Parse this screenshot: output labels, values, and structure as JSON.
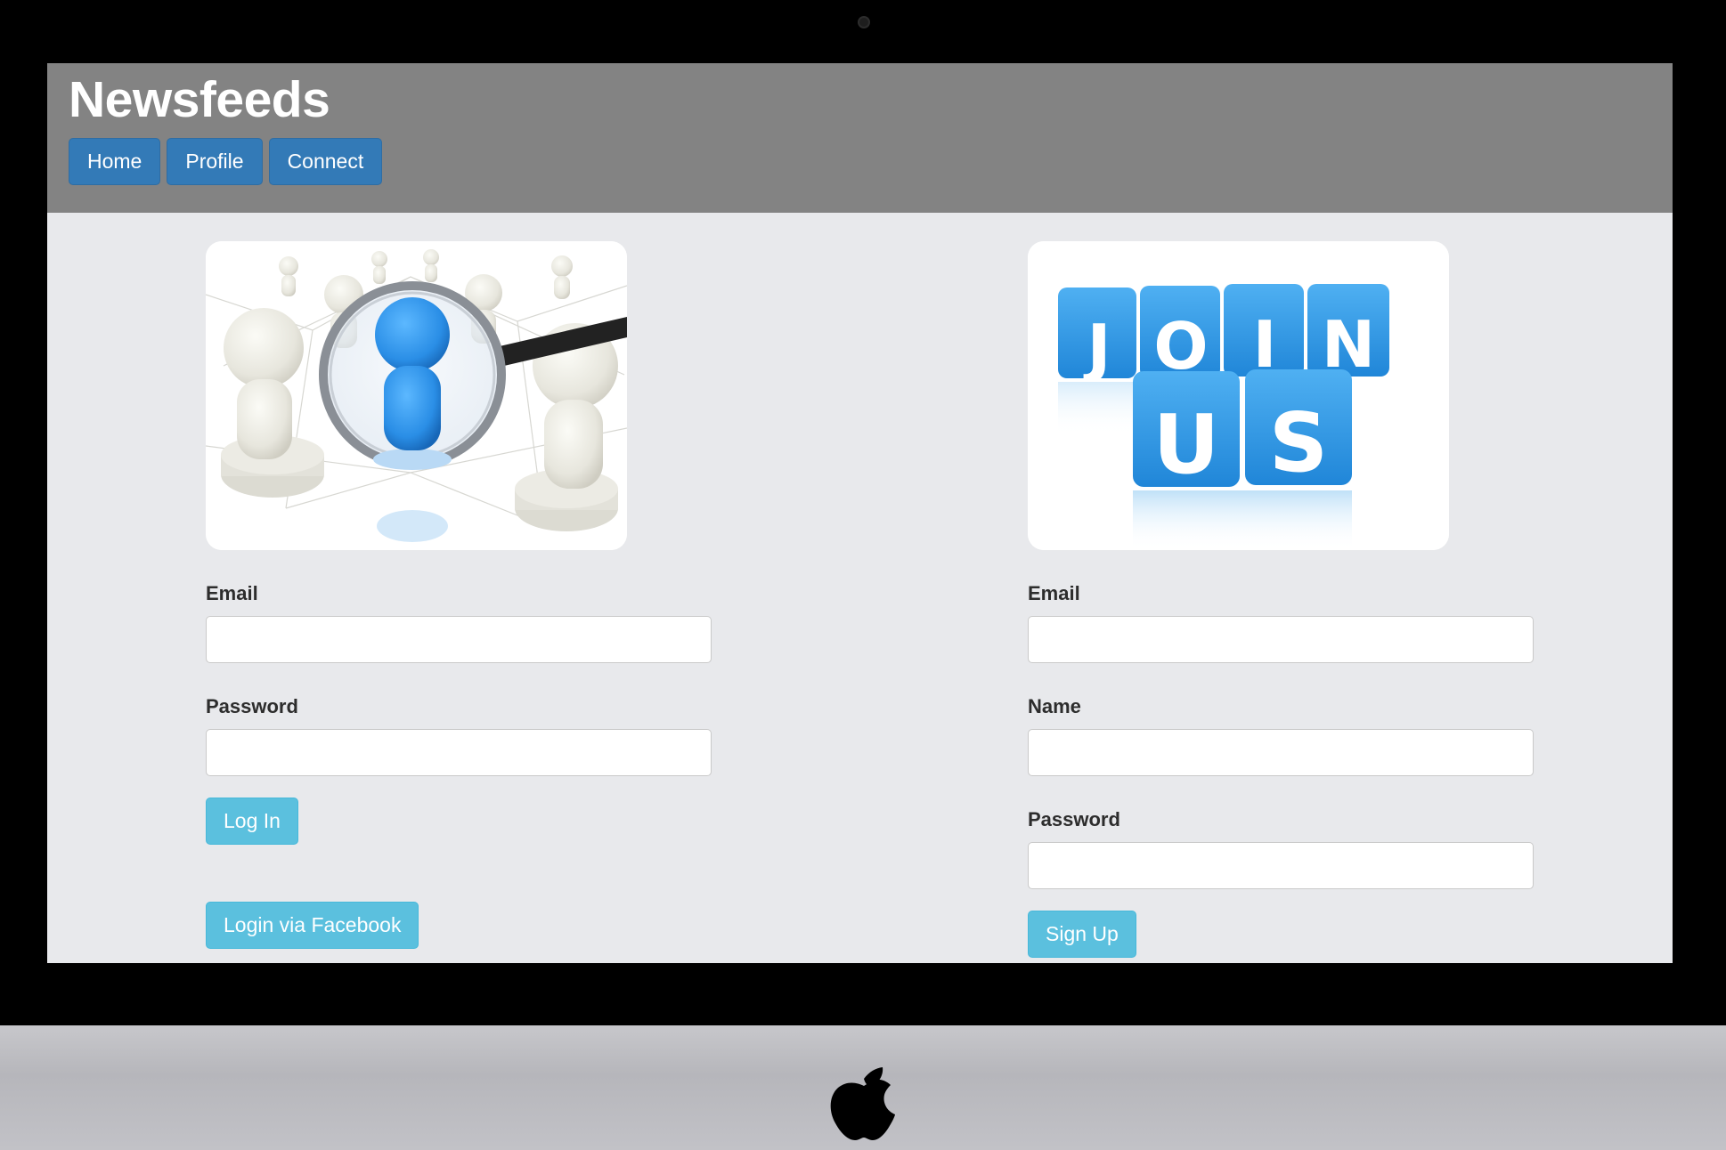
{
  "header": {
    "brand": "Newsfeeds",
    "nav": [
      "Home",
      "Profile",
      "Connect"
    ]
  },
  "login": {
    "image_alt": "search-people-illustration",
    "email_label": "Email",
    "email_value": "",
    "password_label": "Password",
    "password_value": "",
    "login_button": "Log In",
    "facebook_button": "Login via Facebook"
  },
  "signup": {
    "image_text": {
      "row1": [
        "J",
        "O",
        "I",
        "N"
      ],
      "row2": [
        "U",
        "S"
      ]
    },
    "email_label": "Email",
    "email_value": "",
    "name_label": "Name",
    "name_value": "",
    "password_label": "Password",
    "password_value": "",
    "signup_button": "Sign Up"
  },
  "colors": {
    "topbar": "#838383",
    "primary": "#337ab7",
    "info": "#5bc0de",
    "page_bg": "#e8e9ec",
    "cube_blue": "#2e8fdc"
  }
}
